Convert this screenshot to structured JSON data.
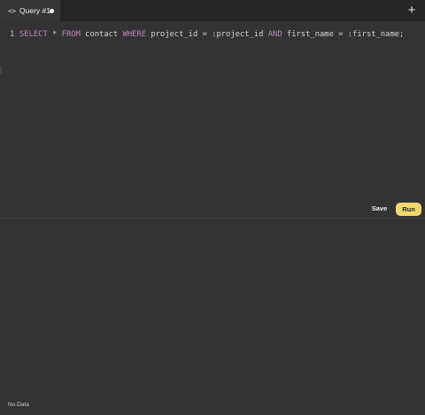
{
  "tabs": [
    {
      "label": "Query #1",
      "icon": "code-icon",
      "icon_glyph": "<>",
      "unsaved": true,
      "active": true
    }
  ],
  "tabbar": {
    "add_icon": "plus-icon",
    "add_glyph": "+"
  },
  "editor": {
    "line_number": "1",
    "tokens": {
      "select": "SELECT",
      "star": "*",
      "from": "FROM",
      "table": "contact",
      "where": "WHERE",
      "col1": "project_id",
      "eq1": "=",
      "param1": ":project_id",
      "and": "AND",
      "col2": "first_name",
      "eq2": "=",
      "param2": ":first_name;"
    }
  },
  "actions": {
    "save_label": "Save",
    "run_label": "Run"
  },
  "results": {
    "status": "No Data"
  },
  "colors": {
    "background": "#333333",
    "tabbar": "#262626",
    "keyword": "#c586c0",
    "run_button": "#f5d76e"
  }
}
